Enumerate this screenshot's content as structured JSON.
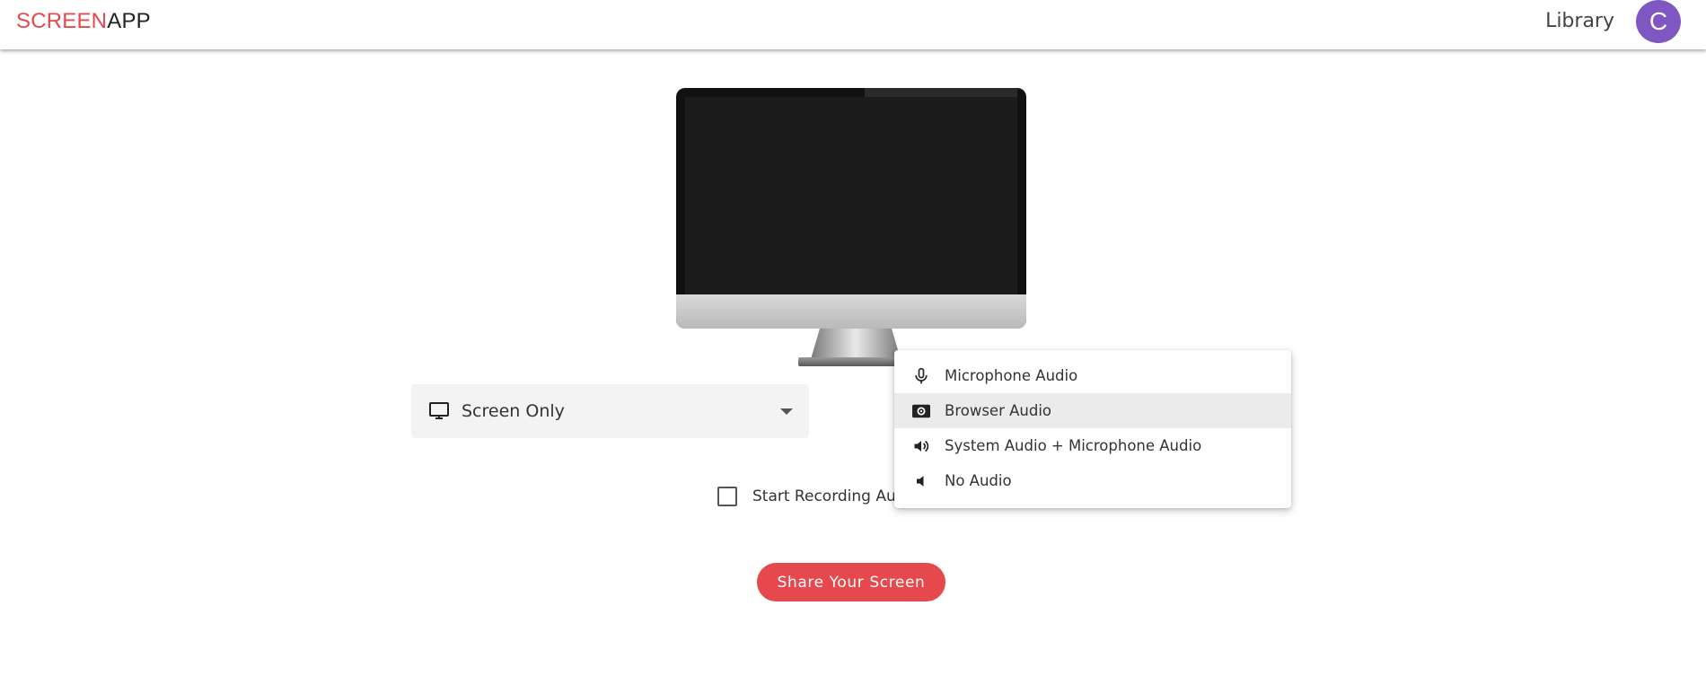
{
  "header": {
    "logo_part1": "SCREEN",
    "logo_part2": "APP",
    "library_label": "Library",
    "avatar_letter": "C"
  },
  "source": {
    "selected_label": "Screen Only",
    "icon": "monitor-icon"
  },
  "auto_record": {
    "label": "Start Recording Auto",
    "checked": false
  },
  "share_button_label": "Share Your Screen",
  "audio_menu": {
    "items": [
      {
        "label": "Microphone Audio",
        "icon": "microphone-icon",
        "selected": false
      },
      {
        "label": "Browser Audio",
        "icon": "browser-audio-icon",
        "selected": true
      },
      {
        "label": "System Audio + Microphone Audio",
        "icon": "speaker-loud-icon",
        "selected": false
      },
      {
        "label": "No Audio",
        "icon": "speaker-mute-icon",
        "selected": false
      }
    ]
  },
  "colors": {
    "brand_red": "#e5484d",
    "avatar_purple": "#7e57c2",
    "menu_selected_bg": "#ebebeb"
  }
}
